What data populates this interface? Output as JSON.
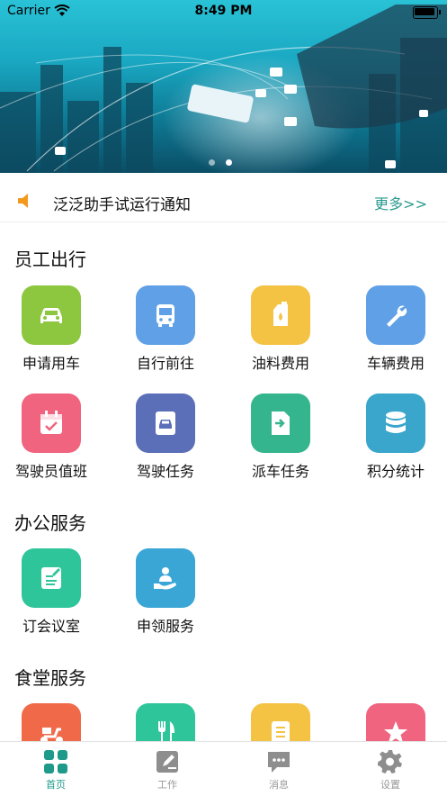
{
  "status": {
    "carrier": "Carrier",
    "time": "8:49 PM"
  },
  "notice": {
    "text": "泛泛助手试运行通知",
    "more": "更多>>"
  },
  "sections": [
    {
      "title": "员工出行",
      "items": [
        {
          "label": "申请用车",
          "icon": "car-icon",
          "color": "#8dc63f"
        },
        {
          "label": "自行前往",
          "icon": "bus-icon",
          "color": "#5fa0e6"
        },
        {
          "label": "油料费用",
          "icon": "fuel-icon",
          "color": "#f5c344"
        },
        {
          "label": "车辆费用",
          "icon": "wrench-icon",
          "color": "#5fa0e6"
        },
        {
          "label": "驾驶员值班",
          "icon": "calendar-icon",
          "color": "#f0647f"
        },
        {
          "label": "驾驶任务",
          "icon": "driving-task-icon",
          "color": "#5a6fb8"
        },
        {
          "label": "派车任务",
          "icon": "dispatch-icon",
          "color": "#34b58e"
        },
        {
          "label": "积分统计",
          "icon": "database-icon",
          "color": "#3aa6cc"
        }
      ]
    },
    {
      "title": "办公服务",
      "items": [
        {
          "label": "订会议室",
          "icon": "meeting-room-icon",
          "color": "#2fc59a"
        },
        {
          "label": "申领服务",
          "icon": "service-icon",
          "color": "#3aa6d6"
        }
      ]
    },
    {
      "title": "食堂服务",
      "items": [
        {
          "label": "",
          "icon": "scooter-icon",
          "color": "#f06a4a"
        },
        {
          "label": "",
          "icon": "cutlery-icon",
          "color": "#2fc59a"
        },
        {
          "label": "",
          "icon": "list-icon",
          "color": "#f5c344"
        },
        {
          "label": "",
          "icon": "star-icon",
          "color": "#f0647f"
        }
      ]
    }
  ],
  "tabs": [
    {
      "label": "首页",
      "icon": "home-grid-icon",
      "active": true
    },
    {
      "label": "工作",
      "icon": "edit-icon",
      "active": false
    },
    {
      "label": "消息",
      "icon": "message-icon",
      "active": false
    },
    {
      "label": "设置",
      "icon": "gear-icon",
      "active": false
    }
  ],
  "colors": {
    "accent": "#1d9a8a",
    "more_link": "#2a9a8e",
    "notice_speaker": "#f39a1e"
  }
}
